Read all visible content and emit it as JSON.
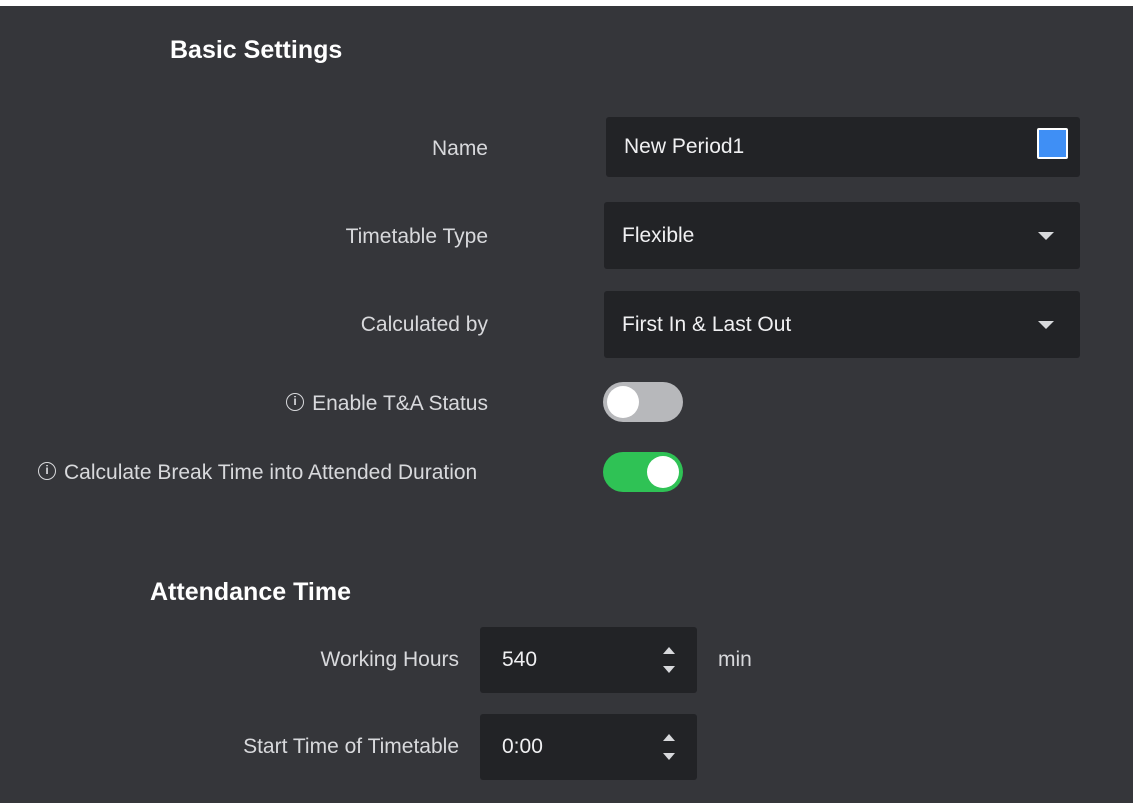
{
  "basic_settings": {
    "title": "Basic Settings",
    "name": {
      "label": "Name",
      "value": "New Period1",
      "swatch_color": "#3f8ff5"
    },
    "timetable_type": {
      "label": "Timetable Type",
      "value": "Flexible"
    },
    "calculated_by": {
      "label": "Calculated by",
      "value": "First In & Last Out"
    },
    "enable_ta_status": {
      "label": "Enable T&A Status",
      "enabled": false
    },
    "calculate_break_time": {
      "label": "Calculate Break Time into Attended Duration",
      "enabled": true
    }
  },
  "attendance_time": {
    "title": "Attendance Time",
    "working_hours": {
      "label": "Working Hours",
      "value": "540",
      "unit": "min"
    },
    "start_time": {
      "label": "Start Time of Timetable",
      "value": "0:00"
    }
  },
  "colors": {
    "panel_bg": "#35363a",
    "field_bg": "#222326",
    "toggle_on": "#2fc255",
    "toggle_off": "#b7b8bb"
  },
  "icons": {
    "info": "info-icon",
    "dropdown": "chevron-down-icon",
    "spinner": "spinner-icon"
  }
}
